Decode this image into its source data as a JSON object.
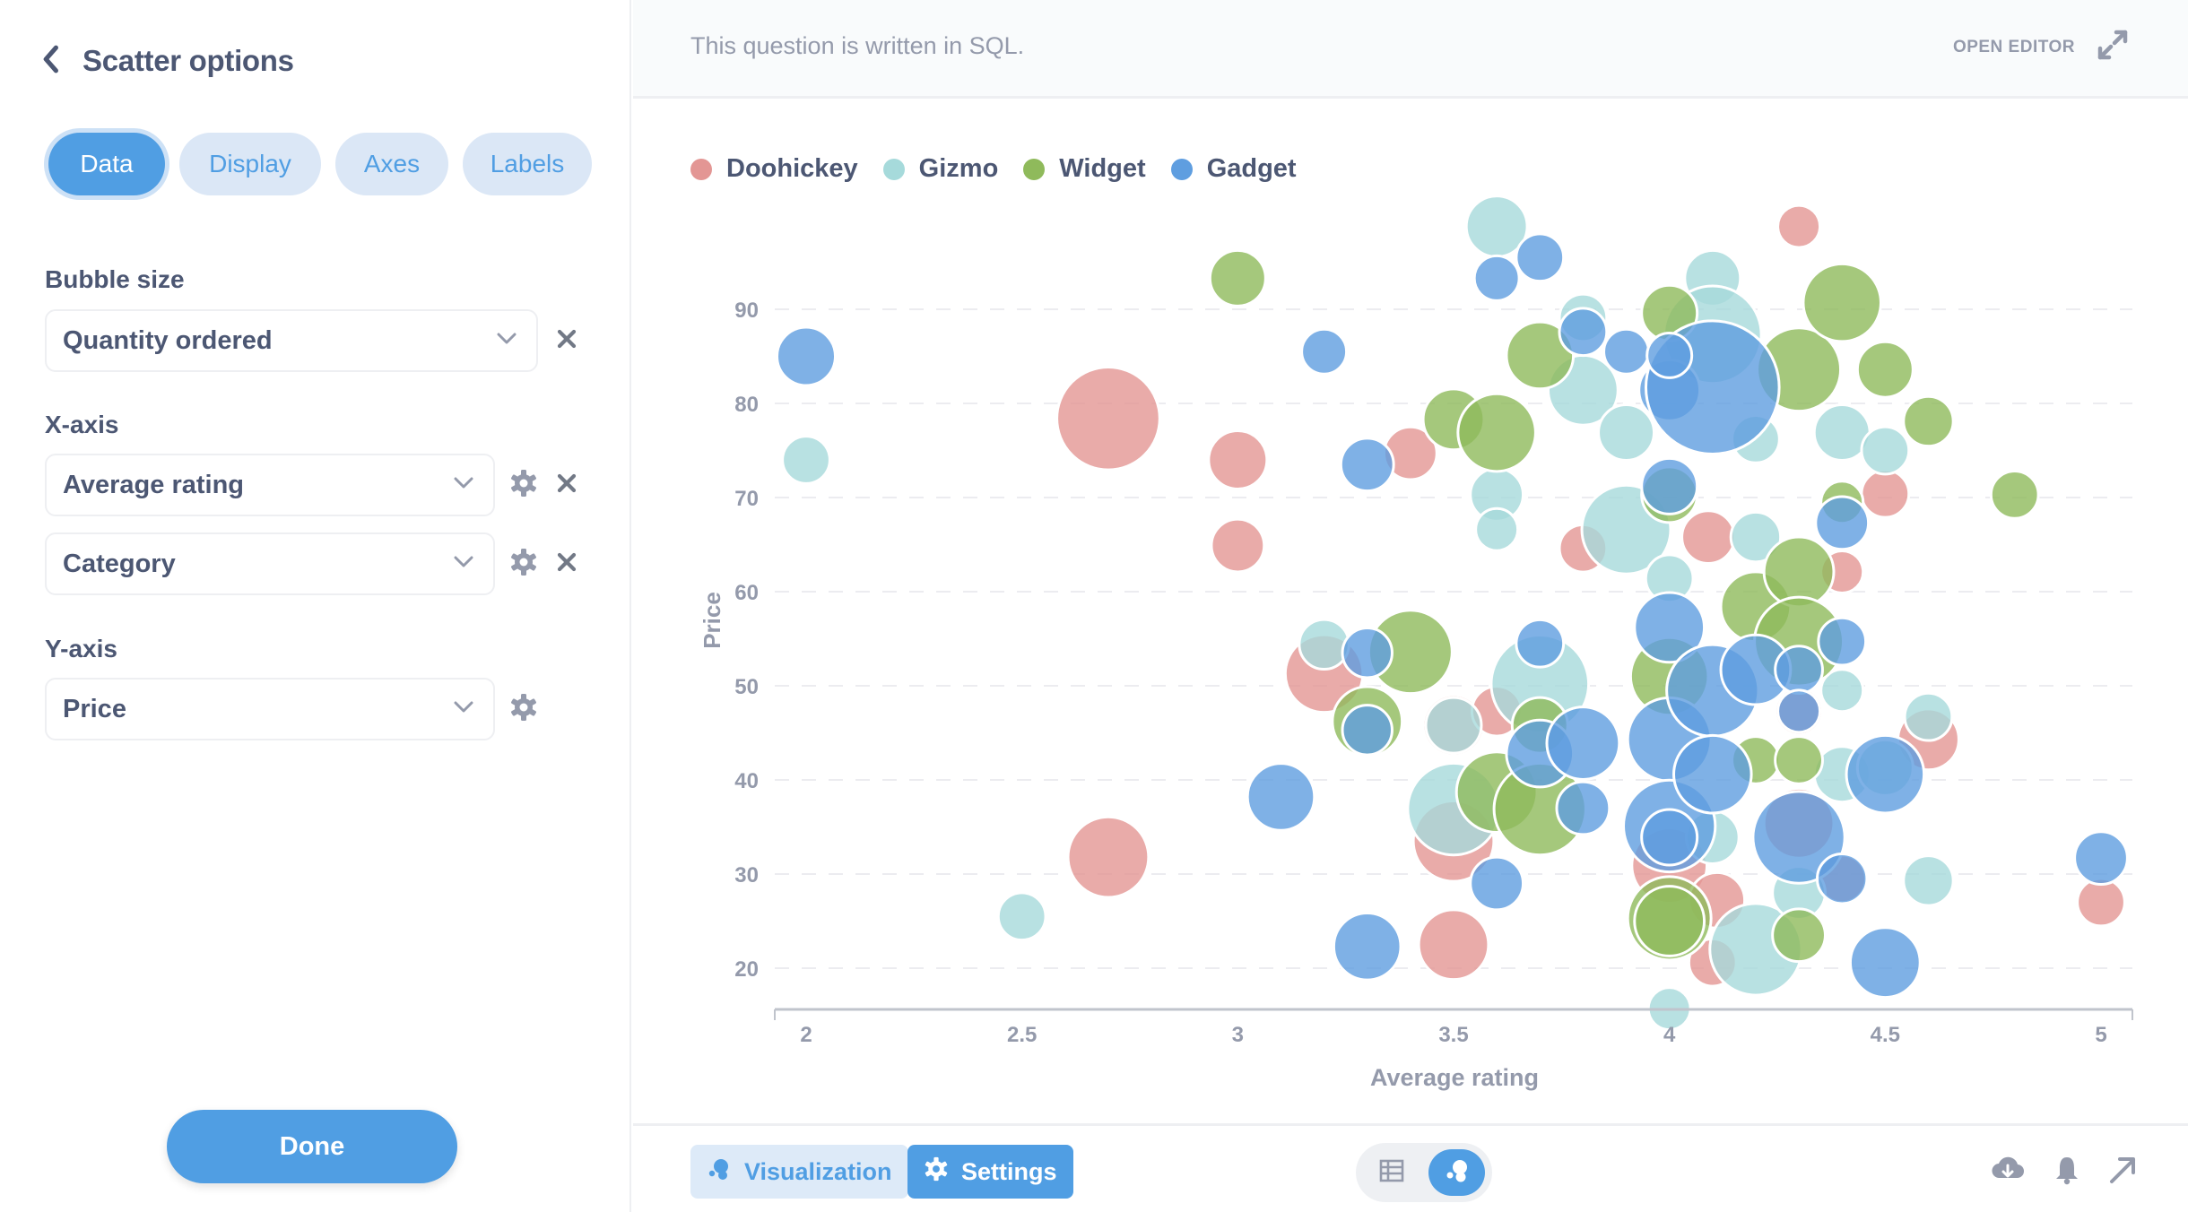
{
  "sidebar": {
    "title": "Scatter options",
    "tabs": [
      {
        "label": "Data",
        "active": true
      },
      {
        "label": "Display",
        "active": false
      },
      {
        "label": "Axes",
        "active": false
      },
      {
        "label": "Labels",
        "active": false
      }
    ],
    "bubble_size": {
      "label": "Bubble size",
      "value": "Quantity ordered"
    },
    "x_axis": {
      "label": "X-axis",
      "values": [
        "Average rating",
        "Category"
      ]
    },
    "y_axis": {
      "label": "Y-axis",
      "value": "Price"
    },
    "done_label": "Done",
    "icons": {
      "back": "chevron-left-icon",
      "chevron": "chevron-down-icon",
      "gear": "gear-icon",
      "remove": "close-icon"
    }
  },
  "topbar": {
    "note": "This question is written in SQL.",
    "open_editor_label": "OPEN EDITOR",
    "open_editor_icon": "expand-icon"
  },
  "bottombar": {
    "visualization_label": "Visualization",
    "settings_label": "Settings",
    "view_toggle": [
      "table-icon",
      "scatter-icon"
    ],
    "active_view": "scatter",
    "actions": [
      "download-icon",
      "bell-icon",
      "share-arrow-icon"
    ]
  },
  "colors": {
    "accent": "#509ee3",
    "Doohickey": "#e39694",
    "Gizmo": "#a6dadb",
    "Widget": "#8fba5b",
    "Gadget": "#5f9ee0"
  },
  "chart_data": {
    "type": "scatter",
    "subtype": "bubble",
    "xlabel": "Average rating",
    "ylabel": "Price",
    "size_field": "Quantity ordered",
    "xlim": [
      1.93,
      5.07
    ],
    "ylim": [
      15.5,
      100
    ],
    "xticks": [
      "2",
      "2.5",
      "3",
      "3.5",
      "4",
      "4.5",
      "5"
    ],
    "xtick_values": [
      2,
      2.5,
      3,
      3.5,
      4,
      4.5,
      5
    ],
    "yticks": [
      "20",
      "30",
      "40",
      "50",
      "60",
      "70",
      "80",
      "90"
    ],
    "ytick_values": [
      20,
      30,
      40,
      50,
      60,
      70,
      80,
      90
    ],
    "grid": "horizontal-dashed",
    "legend_position": "top-left",
    "series": [
      {
        "name": "Doohickey",
        "points": [
          [
            4.3,
            98.8,
            23
          ],
          [
            2.7,
            78.4,
            137
          ],
          [
            3.0,
            74.0,
            44
          ],
          [
            3.0,
            64.9,
            36
          ],
          [
            3.4,
            74.7,
            36
          ],
          [
            4.09,
            65.8,
            36
          ],
          [
            3.8,
            64.6,
            29
          ],
          [
            4.5,
            70.4,
            29
          ],
          [
            4.4,
            62.1,
            23
          ],
          [
            2.7,
            31.8,
            84
          ],
          [
            3.5,
            22.5,
            63
          ],
          [
            3.5,
            33.5,
            84
          ],
          [
            3.2,
            51.3,
            78
          ],
          [
            3.5,
            45.8,
            48
          ],
          [
            3.6,
            47.3,
            32
          ],
          [
            4.3,
            47.3,
            29
          ],
          [
            4.6,
            44.3,
            48
          ],
          [
            5.0,
            27.0,
            29
          ],
          [
            4.1,
            20.6,
            29
          ],
          [
            4.0,
            30.9,
            73
          ],
          [
            4.11,
            27.2,
            40
          ],
          [
            4.3,
            35.4,
            63
          ],
          [
            4.4,
            29.5,
            29
          ]
        ]
      },
      {
        "name": "Gizmo",
        "points": [
          [
            3.6,
            98.8,
            48
          ],
          [
            2.0,
            74.0,
            29
          ],
          [
            2.5,
            25.5,
            29
          ],
          [
            3.8,
            89.1,
            29
          ],
          [
            4.1,
            93.3,
            40
          ],
          [
            4.1,
            87.3,
            123
          ],
          [
            3.8,
            81.4,
            63
          ],
          [
            3.9,
            76.9,
            40
          ],
          [
            3.6,
            70.3,
            36
          ],
          [
            3.6,
            66.6,
            23
          ],
          [
            3.9,
            66.6,
            102
          ],
          [
            4.0,
            61.4,
            29
          ],
          [
            4.2,
            65.8,
            32
          ],
          [
            4.4,
            76.9,
            40
          ],
          [
            4.5,
            75.0,
            29
          ],
          [
            4.2,
            76.2,
            29
          ],
          [
            3.2,
            54.4,
            32
          ],
          [
            3.7,
            50.2,
            123
          ],
          [
            3.5,
            36.9,
            109
          ],
          [
            3.5,
            45.8,
            40
          ],
          [
            4.1,
            33.9,
            36
          ],
          [
            4.2,
            22.0,
            109
          ],
          [
            4.0,
            15.7,
            23
          ],
          [
            4.4,
            49.5,
            23
          ],
          [
            4.4,
            40.6,
            40
          ],
          [
            4.6,
            46.7,
            29
          ],
          [
            4.6,
            29.3,
            32
          ],
          [
            4.3,
            28.0,
            36
          ],
          [
            4.5,
            41.3,
            40
          ]
        ]
      },
      {
        "name": "Widget",
        "points": [
          [
            3.0,
            93.3,
            40
          ],
          [
            3.7,
            85.1,
            58
          ],
          [
            4.0,
            89.6,
            40
          ],
          [
            3.5,
            78.3,
            48
          ],
          [
            3.6,
            76.9,
            78
          ],
          [
            4.3,
            83.6,
            90
          ],
          [
            4.4,
            90.7,
            78
          ],
          [
            4.5,
            83.6,
            40
          ],
          [
            4.6,
            78.1,
            32
          ],
          [
            4.8,
            70.3,
            29
          ],
          [
            4.0,
            70.3,
            40
          ],
          [
            3.4,
            53.6,
            90
          ],
          [
            3.3,
            46.2,
            63
          ],
          [
            3.6,
            38.7,
            84
          ],
          [
            3.7,
            36.9,
            109
          ],
          [
            3.7,
            45.8,
            40
          ],
          [
            4.0,
            51.0,
            78
          ],
          [
            4.0,
            25.3,
            90
          ],
          [
            4.0,
            25.0,
            63
          ],
          [
            4.2,
            58.4,
            63
          ],
          [
            4.3,
            62.1,
            63
          ],
          [
            4.3,
            54.7,
            102
          ],
          [
            4.2,
            42.1,
            29
          ],
          [
            4.3,
            42.1,
            29
          ],
          [
            4.3,
            23.5,
            36
          ],
          [
            4.4,
            69.5,
            23
          ]
        ]
      },
      {
        "name": "Gadget",
        "points": [
          [
            2.0,
            85.0,
            44
          ],
          [
            3.2,
            85.5,
            26
          ],
          [
            3.6,
            93.3,
            26
          ],
          [
            3.7,
            95.5,
            29
          ],
          [
            3.8,
            87.6,
            29
          ],
          [
            3.9,
            85.5,
            26
          ],
          [
            3.3,
            73.5,
            36
          ],
          [
            4.0,
            71.2,
            40
          ],
          [
            4.0,
            81.4,
            48
          ],
          [
            4.1,
            81.7,
            230
          ],
          [
            4.0,
            85.1,
            26
          ],
          [
            4.4,
            67.3,
            36
          ],
          [
            3.1,
            38.2,
            58
          ],
          [
            3.3,
            53.5,
            32
          ],
          [
            3.3,
            45.3,
            32
          ],
          [
            3.7,
            54.5,
            29
          ],
          [
            3.7,
            42.8,
            58
          ],
          [
            3.8,
            43.9,
            68
          ],
          [
            3.8,
            37.0,
            36
          ],
          [
            3.6,
            29.0,
            36
          ],
          [
            3.3,
            22.3,
            58
          ],
          [
            4.0,
            56.2,
            63
          ],
          [
            4.0,
            44.3,
            90
          ],
          [
            4.0,
            35.1,
            109
          ],
          [
            4.0,
            33.9,
            40
          ],
          [
            4.1,
            49.5,
            109
          ],
          [
            4.1,
            40.6,
            78
          ],
          [
            4.2,
            51.7,
            63
          ],
          [
            4.3,
            51.7,
            29
          ],
          [
            4.3,
            47.3,
            23
          ],
          [
            4.4,
            54.7,
            29
          ],
          [
            4.3,
            33.9,
            109
          ],
          [
            4.4,
            29.5,
            32
          ],
          [
            4.5,
            40.6,
            78
          ],
          [
            4.5,
            20.6,
            63
          ],
          [
            5.0,
            31.7,
            36
          ]
        ]
      }
    ]
  }
}
